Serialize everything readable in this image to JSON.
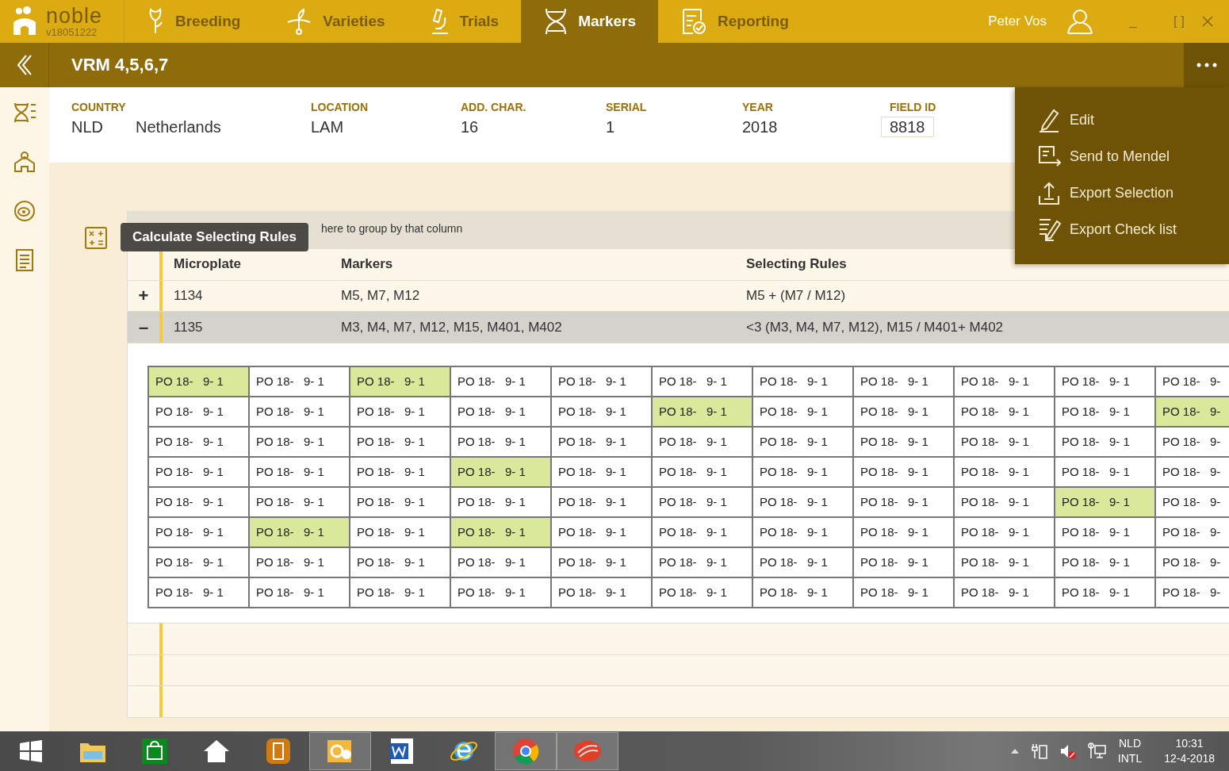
{
  "app": {
    "logo": "noble",
    "version": "v18051222"
  },
  "nav_tabs": [
    {
      "label": "Breeding",
      "selected": false
    },
    {
      "label": "Varieties",
      "selected": false
    },
    {
      "label": "Trials",
      "selected": false
    },
    {
      "label": "Markers",
      "selected": true
    },
    {
      "label": "Reporting",
      "selected": false
    }
  ],
  "user": {
    "name": "Peter Vos"
  },
  "window_controls": [
    "_",
    "[ ]"
  ],
  "header": {
    "title": "VRM 4,5,6,7"
  },
  "details": [
    {
      "label": "COUNTRY",
      "values": [
        "NLD",
        "Netherlands"
      ],
      "kind": "text"
    },
    {
      "label": "LOCATION",
      "values": [
        "LAM"
      ],
      "kind": "text"
    },
    {
      "label": "ADD. CHAR.",
      "values": [
        "16"
      ],
      "kind": "text"
    },
    {
      "label": "SERIAL",
      "values": [
        "1"
      ],
      "kind": "text"
    },
    {
      "label": "YEAR",
      "values": [
        "2018"
      ],
      "kind": "text"
    },
    {
      "label": "FIELD ID",
      "values": [
        "8818"
      ],
      "kind": "input"
    }
  ],
  "menu": [
    {
      "label": "Edit"
    },
    {
      "label": "Send to Mendel"
    },
    {
      "label": "Export Selection"
    },
    {
      "label": "Export Check list"
    }
  ],
  "tooltip": "Calculate Selecting Rules",
  "grid": {
    "group_hint": "here to group by that column",
    "columns": [
      "Microplate",
      "Markers",
      "Selecting Rules"
    ],
    "rows": [
      {
        "toggle": "+",
        "expanded": false,
        "cells": [
          "1134",
          "M5, M7, M12",
          "M5 + (M7 / M12)"
        ]
      },
      {
        "toggle": "–",
        "expanded": true,
        "cells": [
          "1135",
          "M3, M4, M7, M12, M15, M401, M402",
          "<3 (M3, M4, M7, M12), M15 / M401+ M402"
        ]
      }
    ],
    "plate": [
      [
        {
          "text": "PO 18-   9- 1",
          "selected": true
        },
        {
          "text": "PO 18-   9- 1",
          "selected": false
        },
        {
          "text": "PO 18-   9- 1",
          "selected": true
        },
        {
          "text": "PO 18-   9- 1",
          "selected": false
        },
        {
          "text": "PO 18-   9- 1",
          "selected": false
        },
        {
          "text": "PO 18-   9- 1",
          "selected": false
        },
        {
          "text": "PO 18-   9- 1",
          "selected": false
        },
        {
          "text": "PO 18-   9- 1",
          "selected": false
        },
        {
          "text": "PO 18-   9- 1",
          "selected": false
        },
        {
          "text": "PO 18-   9- 1",
          "selected": false
        },
        {
          "text": "PO 18-   9-",
          "selected": false
        }
      ],
      [
        {
          "text": "PO 18-   9- 1",
          "selected": false
        },
        {
          "text": "PO 18-   9- 1",
          "selected": false
        },
        {
          "text": "PO 18-   9- 1",
          "selected": false
        },
        {
          "text": "PO 18-   9- 1",
          "selected": false
        },
        {
          "text": "PO 18-   9- 1",
          "selected": false
        },
        {
          "text": "PO 18-   9- 1",
          "selected": true
        },
        {
          "text": "PO 18-   9- 1",
          "selected": false
        },
        {
          "text": "PO 18-   9- 1",
          "selected": false
        },
        {
          "text": "PO 18-   9- 1",
          "selected": false
        },
        {
          "text": "PO 18-   9- 1",
          "selected": false
        },
        {
          "text": "PO 18-   9-",
          "selected": true
        }
      ],
      [
        {
          "text": "PO 18-   9- 1",
          "selected": false
        },
        {
          "text": "PO 18-   9- 1",
          "selected": false
        },
        {
          "text": "PO 18-   9- 1",
          "selected": false
        },
        {
          "text": "PO 18-   9- 1",
          "selected": false
        },
        {
          "text": "PO 18-   9- 1",
          "selected": false
        },
        {
          "text": "PO 18-   9- 1",
          "selected": false
        },
        {
          "text": "PO 18-   9- 1",
          "selected": false
        },
        {
          "text": "PO 18-   9- 1",
          "selected": false
        },
        {
          "text": "PO 18-   9- 1",
          "selected": false
        },
        {
          "text": "PO 18-   9- 1",
          "selected": false
        },
        {
          "text": "PO 18-   9-",
          "selected": false
        }
      ],
      [
        {
          "text": "PO 18-   9- 1",
          "selected": false
        },
        {
          "text": "PO 18-   9- 1",
          "selected": false
        },
        {
          "text": "PO 18-   9- 1",
          "selected": false
        },
        {
          "text": "PO 18-   9- 1",
          "selected": true
        },
        {
          "text": "PO 18-   9- 1",
          "selected": false
        },
        {
          "text": "PO 18-   9- 1",
          "selected": false
        },
        {
          "text": "PO 18-   9- 1",
          "selected": false
        },
        {
          "text": "PO 18-   9- 1",
          "selected": false
        },
        {
          "text": "PO 18-   9- 1",
          "selected": false
        },
        {
          "text": "PO 18-   9- 1",
          "selected": false
        },
        {
          "text": "PO 18-   9-",
          "selected": false
        }
      ],
      [
        {
          "text": "PO 18-   9- 1",
          "selected": false
        },
        {
          "text": "PO 18-   9- 1",
          "selected": false
        },
        {
          "text": "PO 18-   9- 1",
          "selected": false
        },
        {
          "text": "PO 18-   9- 1",
          "selected": false
        },
        {
          "text": "PO 18-   9- 1",
          "selected": false
        },
        {
          "text": "PO 18-   9- 1",
          "selected": false
        },
        {
          "text": "PO 18-   9- 1",
          "selected": false
        },
        {
          "text": "PO 18-   9- 1",
          "selected": false
        },
        {
          "text": "PO 18-   9- 1",
          "selected": false
        },
        {
          "text": "PO 18-   9- 1",
          "selected": true
        },
        {
          "text": "PO 18-   9-",
          "selected": false
        }
      ],
      [
        {
          "text": "PO 18-   9- 1",
          "selected": false
        },
        {
          "text": "PO 18-   9- 1",
          "selected": true
        },
        {
          "text": "PO 18-   9- 1",
          "selected": false
        },
        {
          "text": "PO 18-   9- 1",
          "selected": true
        },
        {
          "text": "PO 18-   9- 1",
          "selected": false
        },
        {
          "text": "PO 18-   9- 1",
          "selected": false
        },
        {
          "text": "PO 18-   9- 1",
          "selected": false
        },
        {
          "text": "PO 18-   9- 1",
          "selected": false
        },
        {
          "text": "PO 18-   9- 1",
          "selected": false
        },
        {
          "text": "PO 18-   9- 1",
          "selected": false
        },
        {
          "text": "PO 18-   9-",
          "selected": false
        }
      ],
      [
        {
          "text": "PO 18-   9- 1",
          "selected": false
        },
        {
          "text": "PO 18-   9- 1",
          "selected": false
        },
        {
          "text": "PO 18-   9- 1",
          "selected": false
        },
        {
          "text": "PO 18-   9- 1",
          "selected": false
        },
        {
          "text": "PO 18-   9- 1",
          "selected": false
        },
        {
          "text": "PO 18-   9- 1",
          "selected": false
        },
        {
          "text": "PO 18-   9- 1",
          "selected": false
        },
        {
          "text": "PO 18-   9- 1",
          "selected": false
        },
        {
          "text": "PO 18-   9- 1",
          "selected": false
        },
        {
          "text": "PO 18-   9- 1",
          "selected": false
        },
        {
          "text": "PO 18-   9-",
          "selected": false
        }
      ],
      [
        {
          "text": "PO 18-   9- 1",
          "selected": false
        },
        {
          "text": "PO 18-   9- 1",
          "selected": false
        },
        {
          "text": "PO 18-   9- 1",
          "selected": false
        },
        {
          "text": "PO 18-   9- 1",
          "selected": false
        },
        {
          "text": "PO 18-   9- 1",
          "selected": false
        },
        {
          "text": "PO 18-   9- 1",
          "selected": false
        },
        {
          "text": "PO 18-   9- 1",
          "selected": false
        },
        {
          "text": "PO 18-   9- 1",
          "selected": false
        },
        {
          "text": "PO 18-   9- 1",
          "selected": false
        },
        {
          "text": "PO 18-   9- 1",
          "selected": false
        },
        {
          "text": "PO 18-   9-",
          "selected": false
        }
      ]
    ]
  },
  "taskbar": [
    {
      "selected": false
    },
    {
      "selected": false
    },
    {
      "selected": false
    },
    {
      "selected": false
    },
    {
      "selected": false
    },
    {
      "selected": true
    },
    {
      "selected": false
    },
    {
      "selected": false
    },
    {
      "selected": true
    },
    {
      "selected": true
    }
  ],
  "tray": {
    "language": "NLD",
    "layout": "INTL",
    "time": "10:31",
    "date": "12-4-2018"
  }
}
